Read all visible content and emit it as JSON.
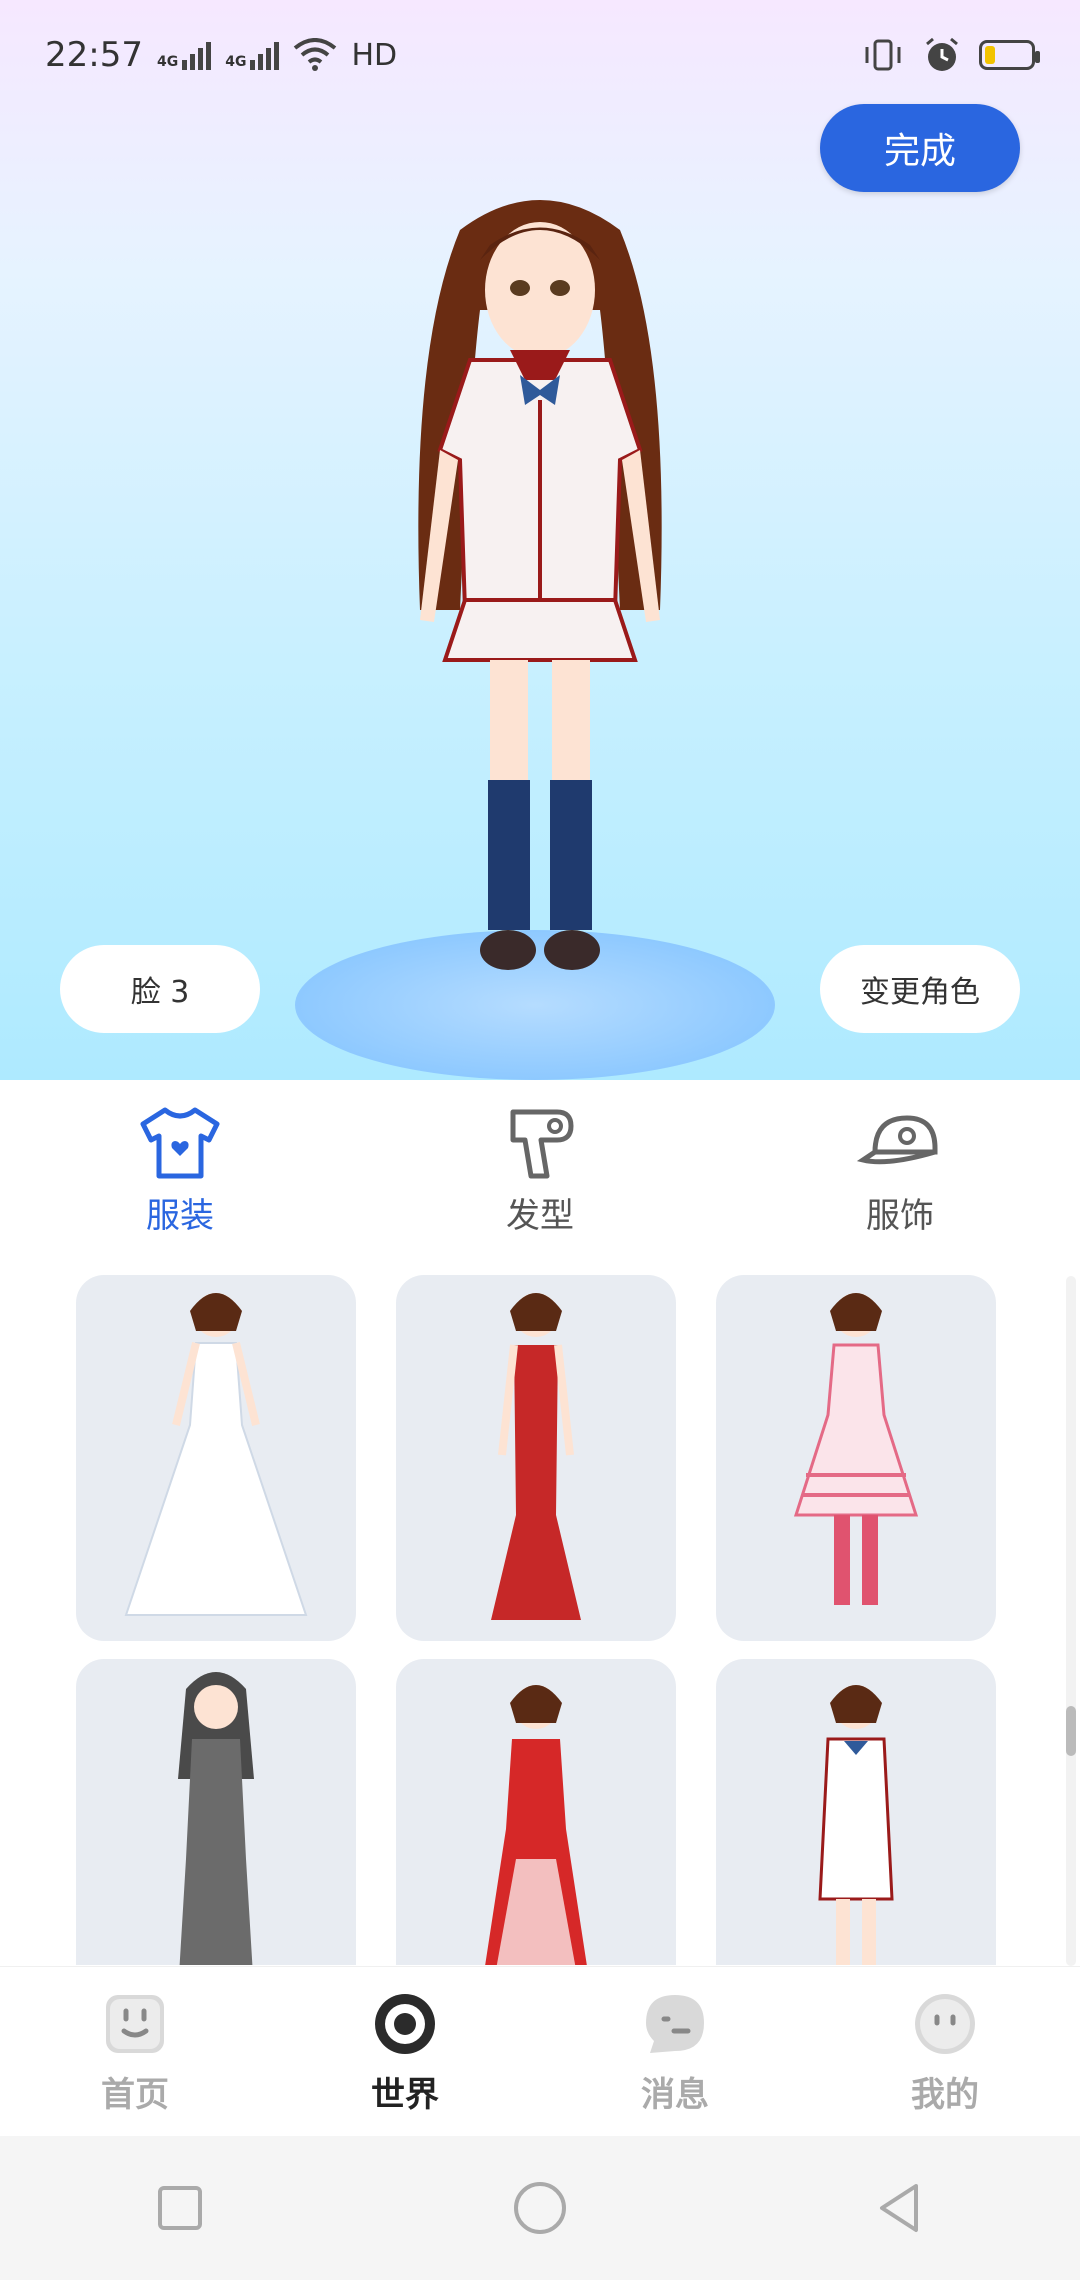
{
  "status_bar": {
    "time": "22:57",
    "net1": "4G",
    "net2": "4G",
    "hd": "HD",
    "icons": [
      "signal-icon",
      "wifi-icon",
      "vibrate-icon",
      "alarm-icon",
      "battery-icon"
    ]
  },
  "hero": {
    "done_label": "完成",
    "face_label": "脸 3",
    "change_character_label": "变更角色"
  },
  "categories": [
    {
      "label": "服装",
      "icon": "shirt-icon",
      "active": true
    },
    {
      "label": "发型",
      "icon": "hairdryer-icon",
      "active": false
    },
    {
      "label": "服饰",
      "icon": "cap-icon",
      "active": false
    }
  ],
  "outfits": [
    {
      "name": "white-wedding-dress"
    },
    {
      "name": "red-evening-gown"
    },
    {
      "name": "pink-lolita-dress"
    },
    {
      "name": "gray-nun-dress"
    },
    {
      "name": "red-princess-dress"
    },
    {
      "name": "school-uniform"
    }
  ],
  "bottom_nav": [
    {
      "label": "首页",
      "icon": "home-face-icon",
      "active": false
    },
    {
      "label": "世界",
      "icon": "world-icon",
      "active": true
    },
    {
      "label": "消息",
      "icon": "message-icon",
      "active": false
    },
    {
      "label": "我的",
      "icon": "profile-icon",
      "active": false
    }
  ],
  "colors": {
    "accent": "#2a66e0",
    "card_bg": "#e8ecf2"
  }
}
